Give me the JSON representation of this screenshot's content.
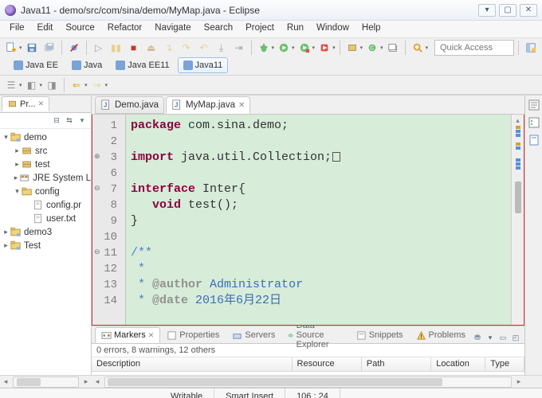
{
  "window": {
    "title": "Java11 - demo/src/com/sina/demo/MyMap.java - Eclipse"
  },
  "menu": [
    "File",
    "Edit",
    "Source",
    "Refactor",
    "Navigate",
    "Search",
    "Project",
    "Run",
    "Window",
    "Help"
  ],
  "quick_access_placeholder": "Quick Access",
  "perspectives": [
    {
      "label": "Java EE",
      "active": false
    },
    {
      "label": "Java",
      "active": false
    },
    {
      "label": "Java EE11",
      "active": false
    },
    {
      "label": "Java11",
      "active": true
    }
  ],
  "package_explorer": {
    "tab_label": "Pr...",
    "nodes": [
      {
        "depth": 1,
        "twisty": "▾",
        "icon": "project",
        "label": "demo"
      },
      {
        "depth": 2,
        "twisty": "▸",
        "icon": "pkg",
        "label": "src"
      },
      {
        "depth": 2,
        "twisty": "▸",
        "icon": "pkg",
        "label": "test"
      },
      {
        "depth": 2,
        "twisty": "▸",
        "icon": "jre",
        "label": "JRE System L"
      },
      {
        "depth": 2,
        "twisty": "▾",
        "icon": "folder",
        "label": "config"
      },
      {
        "depth": 3,
        "twisty": "",
        "icon": "file",
        "label": "config.pr"
      },
      {
        "depth": 3,
        "twisty": "",
        "icon": "file",
        "label": "user.txt"
      },
      {
        "depth": 1,
        "twisty": "▸",
        "icon": "project",
        "label": "demo3"
      },
      {
        "depth": 1,
        "twisty": "▸",
        "icon": "project",
        "label": "Test"
      }
    ]
  },
  "editor": {
    "tabs": [
      {
        "label": "Demo.java",
        "active": false
      },
      {
        "label": "MyMap.java",
        "active": true
      }
    ],
    "lines": [
      {
        "n": 1,
        "html": "<span class='kw'>package</span> com.sina.demo;"
      },
      {
        "n": 2,
        "html": ""
      },
      {
        "n": 3,
        "html": "<span class='kw'>import</span> java.util.Collection;<span class='sqbox'></span>",
        "fold": "⊕"
      },
      {
        "n": 6,
        "html": ""
      },
      {
        "n": 7,
        "html": "<span class='kw'>interface</span> Inter{",
        "fold": "⊖"
      },
      {
        "n": 8,
        "html": "   <span class='kw'>void</span> test();"
      },
      {
        "n": 9,
        "html": "}"
      },
      {
        "n": 10,
        "html": ""
      },
      {
        "n": 11,
        "html": "<span class='jdoc'>/**</span>",
        "fold": "⊖"
      },
      {
        "n": 12,
        "html": "<span class='jdoc'> *</span>"
      },
      {
        "n": 13,
        "html": "<span class='jdoc'> * <span class='jdoc-tag'>@author</span> <span class='jdoc-lnk'>Administrator</span></span>"
      },
      {
        "n": 14,
        "html": "<span class='jdoc'> * <span class='jdoc-tag'>@date</span> <span class='jdoc-lnk'>2016年6月22日</span></span>"
      }
    ]
  },
  "markers": {
    "tabs": [
      "Markers",
      "Properties",
      "Servers",
      "Data Source Explorer",
      "Snippets",
      "Problems"
    ],
    "active_tab": 0,
    "summary": "0 errors, 8 warnings, 12 others",
    "columns": [
      "Description",
      "Resource",
      "Path",
      "Location",
      "Type"
    ]
  },
  "status": {
    "writable": "Writable",
    "insert": "Smart Insert",
    "cursor": "106 : 24"
  }
}
